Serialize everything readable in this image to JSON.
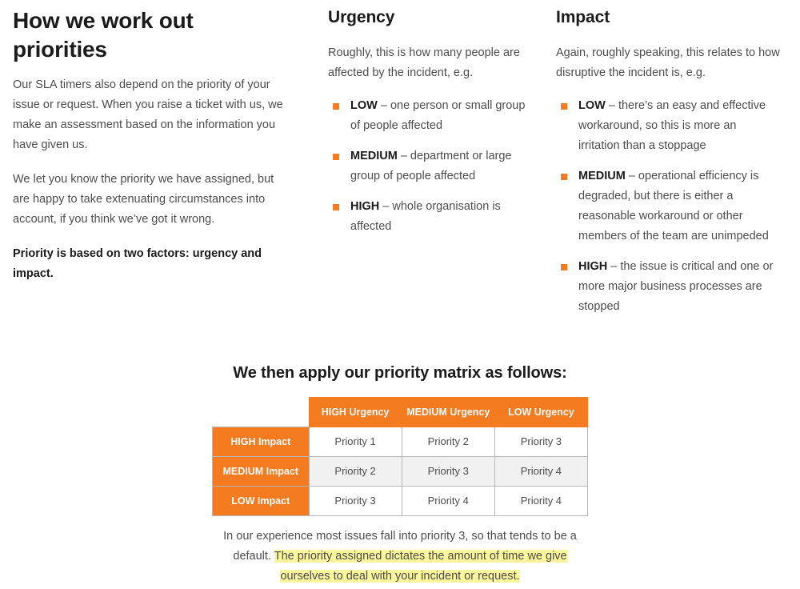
{
  "colors": {
    "accent_orange": "#f47b20",
    "highlight_yellow": "#fbf59b",
    "body_text": "#4d4d4d",
    "heading_text": "#1b1b1b",
    "table_border": "#b7b7b7",
    "alt_row": "#f1f1f1"
  },
  "left_column": {
    "title": "How we work out priorities",
    "paragraph_1": "Our SLA timers also depend on the priority of your issue or request. When you raise a ticket with us, we make an assessment based on the information you have given us.",
    "paragraph_2": "We let you know the priority we have assigned, but are happy to take extenuating circumstances into account, if you think we’ve got it wrong.",
    "paragraph_3": "Priority is based on two factors: urgency and impact."
  },
  "urgency_column": {
    "title": "Urgency",
    "intro": "Roughly, this is how many people are affected by the incident, e.g.",
    "items": [
      {
        "level": "LOW",
        "description": "– one person or small group of people affected"
      },
      {
        "level": "MEDIUM",
        "description": "– department or large group of people affected"
      },
      {
        "level": "HIGH",
        "description": "– whole organisation is affected"
      }
    ]
  },
  "impact_column": {
    "title": "Impact",
    "intro": "Again, roughly speaking, this relates to how disruptive the incident is, e.g.",
    "items": [
      {
        "level": "LOW",
        "description": "– there’s an easy and effective workaround, so this is more an irritation than a stoppage"
      },
      {
        "level": "MEDIUM",
        "description": "– operational efficiency is degraded, but there is either a reasonable workaround or other members of the team are unimpeded"
      },
      {
        "level": "HIGH",
        "description": "– the issue is critical and one or more major business processes are stopped"
      }
    ]
  },
  "matrix": {
    "title": "We then apply our priority matrix as follows:",
    "corner_label": "",
    "column_headers": [
      "HIGH Urgency",
      "MEDIUM Urgency",
      "LOW Urgency"
    ],
    "rows": [
      {
        "header": "HIGH Impact",
        "cells": [
          "Priority 1",
          "Priority 2",
          "Priority 3"
        ]
      },
      {
        "header": "MEDIUM Impact",
        "cells": [
          "Priority 2",
          "Priority 3",
          "Priority 4"
        ]
      },
      {
        "header": "LOW Impact",
        "cells": [
          "Priority 3",
          "Priority 4",
          "Priority 4"
        ]
      }
    ]
  },
  "footer": {
    "text_plain": "In our experience most issues fall into priority 3, so that tends to be a default. ",
    "text_highlighted": "The priority assigned dictates the amount of time we give ourselves to deal with your incident or request."
  }
}
